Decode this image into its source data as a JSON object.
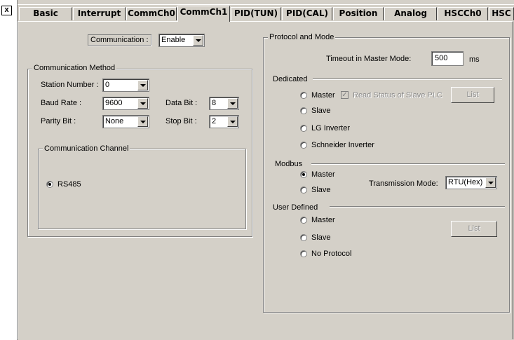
{
  "window": {
    "close_glyph": "x"
  },
  "tabs": [
    {
      "label": "Basic"
    },
    {
      "label": "Interrupt"
    },
    {
      "label": "CommCh0"
    },
    {
      "label": "CommCh1",
      "active": true
    },
    {
      "label": "PID(TUN)"
    },
    {
      "label": "PID(CAL)"
    },
    {
      "label": "Position"
    },
    {
      "label": "Analog"
    },
    {
      "label": "HSCCh0"
    },
    {
      "label": "HSC"
    }
  ],
  "communication": {
    "label": "Communication :",
    "value": "Enable"
  },
  "method": {
    "title": "Communication Method",
    "station_number": {
      "label": "Station Number :",
      "value": "0"
    },
    "baud_rate": {
      "label": "Baud Rate :",
      "value": "9600"
    },
    "parity_bit": {
      "label": "Parity Bit :",
      "value": "None"
    },
    "data_bit": {
      "label": "Data Bit :",
      "value": "8"
    },
    "stop_bit": {
      "label": "Stop Bit :",
      "value": "2"
    },
    "channel": {
      "title": "Communication Channel",
      "rs485": "RS485",
      "rs485_selected": true
    }
  },
  "protocol": {
    "title": "Protocol and Mode",
    "timeout": {
      "label": "Timeout in Master Mode:",
      "value": "500",
      "unit": "ms"
    },
    "dedicated": {
      "title": "Dedicated",
      "master": "Master",
      "read_status": "Read Status of Slave PLC",
      "read_status_checked": true,
      "list_button": "List",
      "slave": "Slave",
      "lg_inverter": "LG Inverter",
      "schneider_inverter": "Schneider Inverter"
    },
    "modbus": {
      "title": "Modbus",
      "master": "Master",
      "master_selected": true,
      "slave": "Slave",
      "transmission_label": "Transmission Mode:",
      "transmission_value": "RTU(Hex)"
    },
    "user_defined": {
      "title": "User Defined",
      "master": "Master",
      "slave": "Slave",
      "no_protocol": "No Protocol",
      "list_button": "List"
    }
  }
}
